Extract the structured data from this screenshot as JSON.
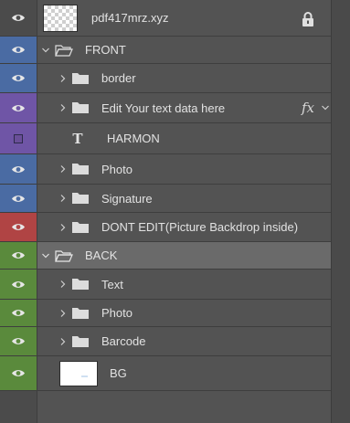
{
  "colors": {
    "blue": "#4a6ba3",
    "purple": "#6f55a6",
    "red": "#b04444",
    "green": "#5a8a3c",
    "panel": "#535353",
    "selected_row": "#6a6a6a"
  },
  "layers": [
    {
      "name": "pdf417mrz.xyz",
      "kind": "smart-object",
      "locked": true
    },
    {
      "name": "FRONT",
      "kind": "group-open",
      "color": "blue"
    },
    {
      "name": "border",
      "kind": "group",
      "color": "blue"
    },
    {
      "name": "Edit Your text data here",
      "kind": "group",
      "color": "purple",
      "effects": "fx"
    },
    {
      "name": "HARMON",
      "kind": "text",
      "color": "purple",
      "visible": false
    },
    {
      "name": "Photo",
      "kind": "group",
      "color": "blue"
    },
    {
      "name": "Signature",
      "kind": "group",
      "color": "blue"
    },
    {
      "name": "DONT EDIT(Picture Backdrop inside)",
      "kind": "group",
      "color": "red"
    },
    {
      "name": "BACK",
      "kind": "group-open",
      "color": "green",
      "selected": true
    },
    {
      "name": "Text",
      "kind": "group",
      "color": "green"
    },
    {
      "name": "Photo",
      "kind": "group",
      "color": "green"
    },
    {
      "name": "Barcode",
      "kind": "group",
      "color": "green"
    },
    {
      "name": "BG",
      "kind": "raster",
      "color": "green"
    }
  ],
  "icons": {
    "visibility": "eye-icon",
    "lock": "lock-icon",
    "folder": "folder-icon",
    "open_folder": "open-folder-icon",
    "expand": "chevron-right-icon",
    "collapse": "chevron-down-icon",
    "text_layer": "text-layer-icon",
    "effects": "fx-icon"
  }
}
